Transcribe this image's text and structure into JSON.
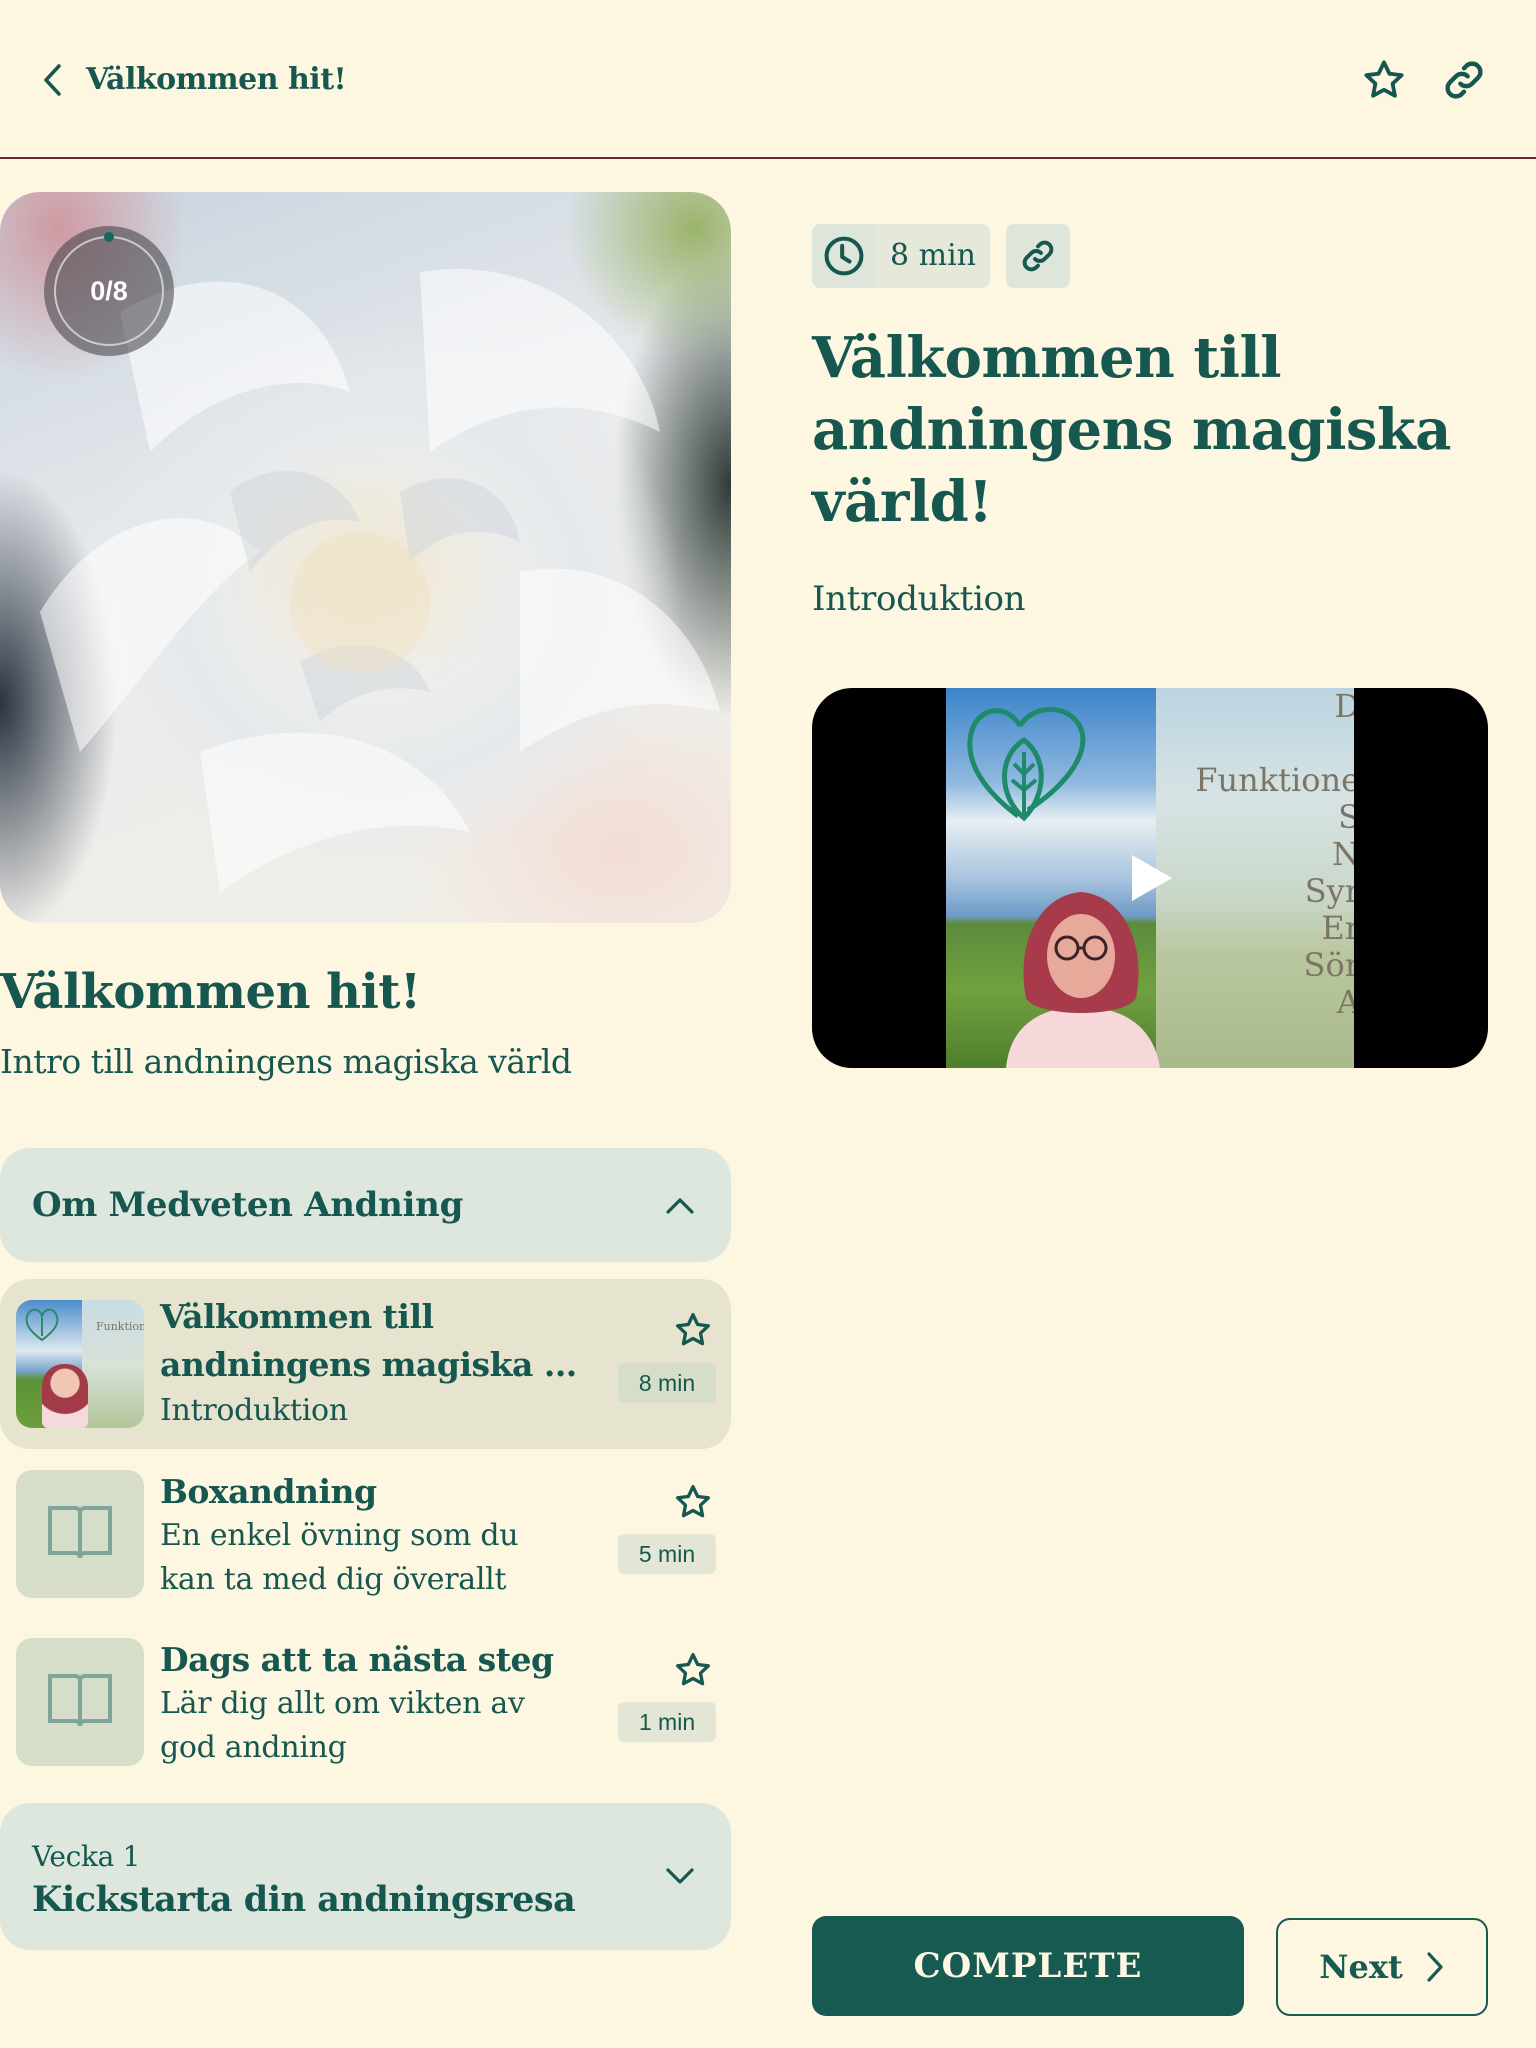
{
  "header": {
    "back_label": "Välkommen hit!",
    "icons": {
      "back": "chevron-left-icon",
      "favorite": "star-icon",
      "share": "link-icon"
    }
  },
  "course": {
    "progress_text": "0/8",
    "progress_completed": 0,
    "progress_total": 8,
    "title": "Välkommen hit!",
    "subtitle": "Intro till andningens magiska värld"
  },
  "sections": [
    {
      "title": "Om Medveten Andning",
      "expanded": true,
      "lessons": [
        {
          "title": "Välkommen till andningens magiska ...",
          "description": "Introduktion",
          "duration": "8 min",
          "thumbnail": "video-thumbnail",
          "active": true
        },
        {
          "title": "Boxandning",
          "description": "En enkel övning som du kan ta med dig överallt",
          "duration": "5 min",
          "thumbnail": "book-icon",
          "active": false
        },
        {
          "title": "Dags att ta nästa steg",
          "description": "Lär dig allt om vikten av god andning",
          "duration": "1 min",
          "thumbnail": "book-icon",
          "active": false
        }
      ]
    },
    {
      "kicker": "Vecka 1",
      "title": "Kickstarta din andningsresa",
      "expanded": false
    }
  ],
  "lesson": {
    "duration": "8 min",
    "title": "Välkommen till andningens magiska värld!",
    "kicker": "Introduktion",
    "video_overlay_lines": [
      "D",
      "",
      "Funktione",
      "S",
      "N",
      "Syr",
      "Er",
      "Sör",
      "A"
    ]
  },
  "actions": {
    "complete_label": "COMPLETE",
    "next_label": "Next"
  },
  "colors": {
    "background": "#fdf6e1",
    "primary": "#175a51",
    "divider": "#6a2639",
    "section_bg": "#dee7de",
    "active_lesson_bg": "#e6e4cf"
  }
}
